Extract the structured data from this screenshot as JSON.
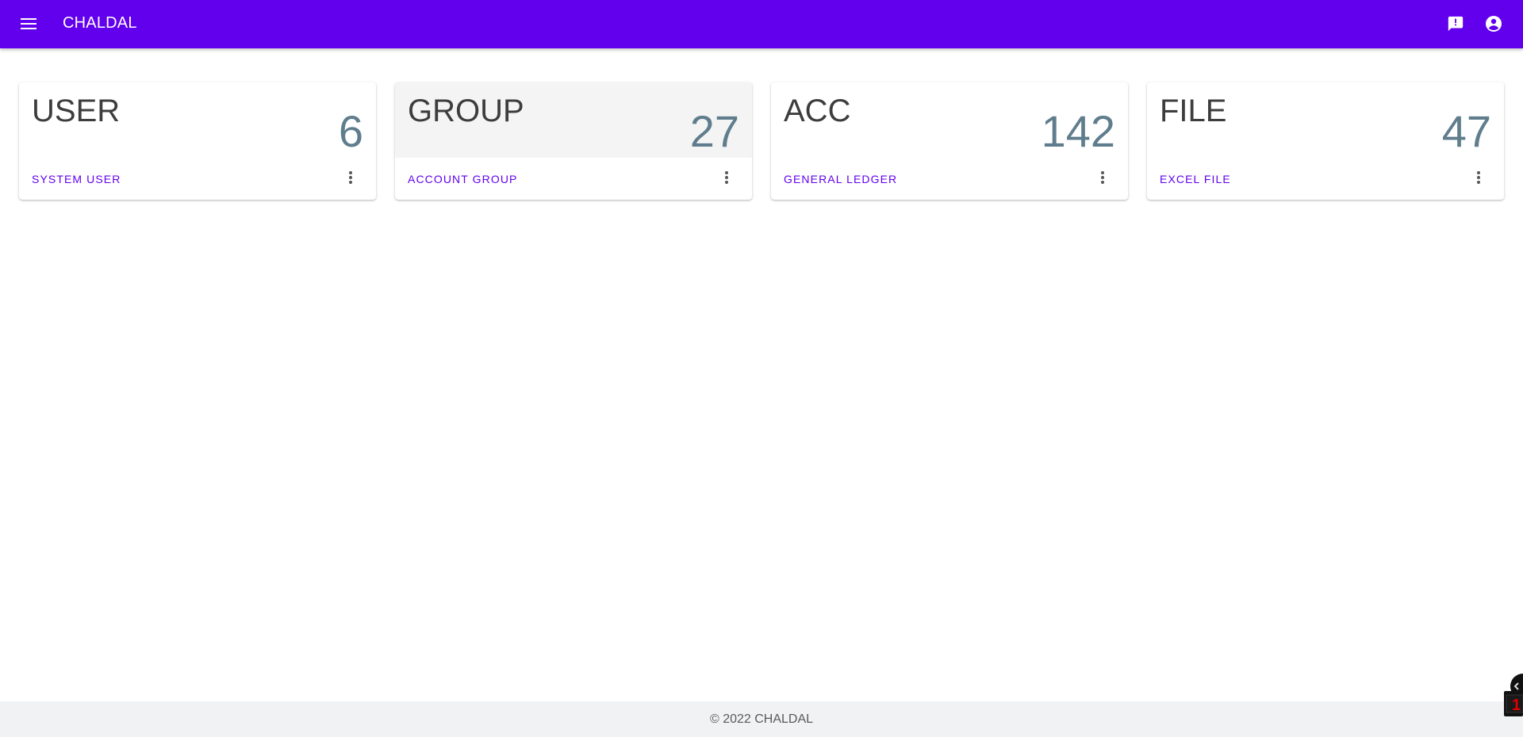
{
  "app": {
    "title": "CHALDAL",
    "accent_color": "#6200ee"
  },
  "header": {
    "menu_icon": "hamburger-menu-icon",
    "actions": [
      {
        "icon": "feedback-icon"
      },
      {
        "icon": "account-circle-icon"
      }
    ]
  },
  "cards": [
    {
      "title": "USER",
      "count": "6",
      "link": "SYSTEM USER",
      "menu_icon": "more-vert-icon"
    },
    {
      "title": "GROUP",
      "count": "27",
      "link": "ACCOUNT GROUP",
      "menu_icon": "more-vert-icon"
    },
    {
      "title": "ACC",
      "count": "142",
      "link": "GENERAL LEDGER",
      "menu_icon": "more-vert-icon"
    },
    {
      "title": "FILE",
      "count": "47",
      "link": "EXCEL FILE",
      "menu_icon": "more-vert-icon"
    }
  ],
  "widget": {
    "badge": "1"
  },
  "footer": {
    "text": "© 2022 CHALDAL"
  }
}
